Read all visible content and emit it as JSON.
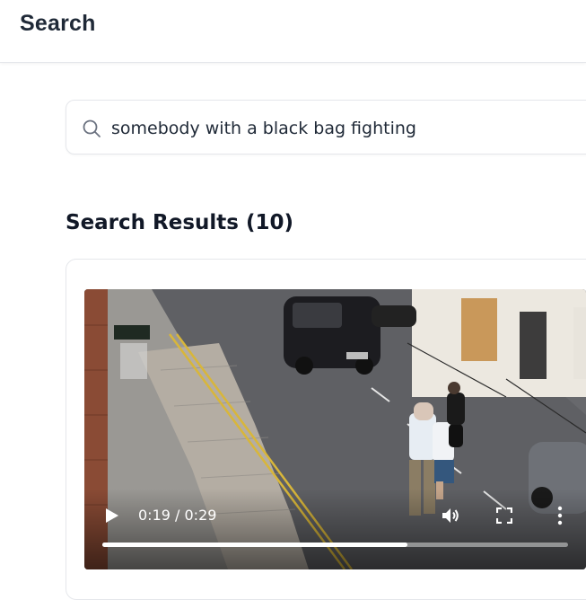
{
  "header": {
    "title": "Search"
  },
  "search": {
    "query": "somebody with a black bag fighting",
    "icon": "search-icon"
  },
  "results": {
    "heading": "Search Results (10)"
  },
  "video": {
    "time_display": "0:19 / 0:29",
    "progress_fraction": 0.655,
    "controls": {
      "play": "play-icon",
      "volume": "volume-icon",
      "fullscreen": "fullscreen-icon",
      "more": "more-vert-icon"
    }
  },
  "colors": {
    "text": "#111827",
    "border": "#e5e7eb",
    "muted_icon": "#6b7280"
  }
}
